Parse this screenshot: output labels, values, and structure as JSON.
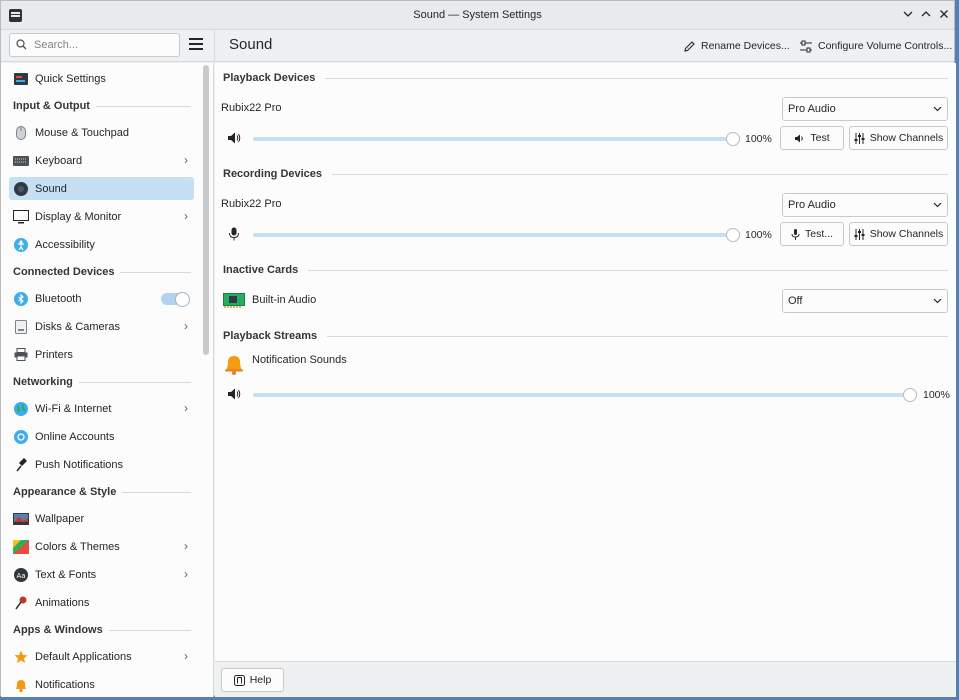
{
  "window": {
    "title": "Sound — System Settings"
  },
  "header": {
    "search_placeholder": "Search...",
    "page_title": "Sound",
    "rename_label": "Rename Devices...",
    "configure_label": "Configure Volume Controls..."
  },
  "sidebar": {
    "quick_settings": "Quick Settings",
    "sec_input_output": "Input & Output",
    "mouse": "Mouse & Touchpad",
    "keyboard": "Keyboard",
    "sound": "Sound",
    "display": "Display & Monitor",
    "accessibility": "Accessibility",
    "sec_connected": "Connected Devices",
    "bluetooth": "Bluetooth",
    "disks": "Disks & Cameras",
    "printers": "Printers",
    "sec_networking": "Networking",
    "wifi": "Wi-Fi & Internet",
    "online_accounts": "Online Accounts",
    "push_notifications": "Push Notifications",
    "sec_appearance": "Appearance & Style",
    "wallpaper": "Wallpaper",
    "colors_themes": "Colors & Themes",
    "text_fonts": "Text & Fonts",
    "animations": "Animations",
    "sec_apps_windows": "Apps & Windows",
    "default_apps": "Default Applications",
    "notifications": "Notifications"
  },
  "playback": {
    "title": "Playback Devices",
    "device_name": "Rubix22 Pro",
    "profile": "Pro Audio",
    "volume": "100%",
    "volume_fraction": 1.0,
    "test_label": "Test",
    "channels_label": "Show Channels"
  },
  "recording": {
    "title": "Recording Devices",
    "device_name": "Rubix22 Pro",
    "profile": "Pro Audio",
    "volume": "100%",
    "volume_fraction": 1.0,
    "test_label": "Test...",
    "channels_label": "Show Channels"
  },
  "inactive": {
    "title": "Inactive Cards",
    "card_name": "Built-in Audio",
    "profile": "Off"
  },
  "streams": {
    "title": "Playback Streams",
    "stream_name": "Notification Sounds",
    "volume": "100%",
    "volume_fraction": 1.0
  },
  "footer": {
    "help_label": "Help"
  },
  "colors": {
    "accent": "#3daee9",
    "selection": "#c6dff3"
  }
}
